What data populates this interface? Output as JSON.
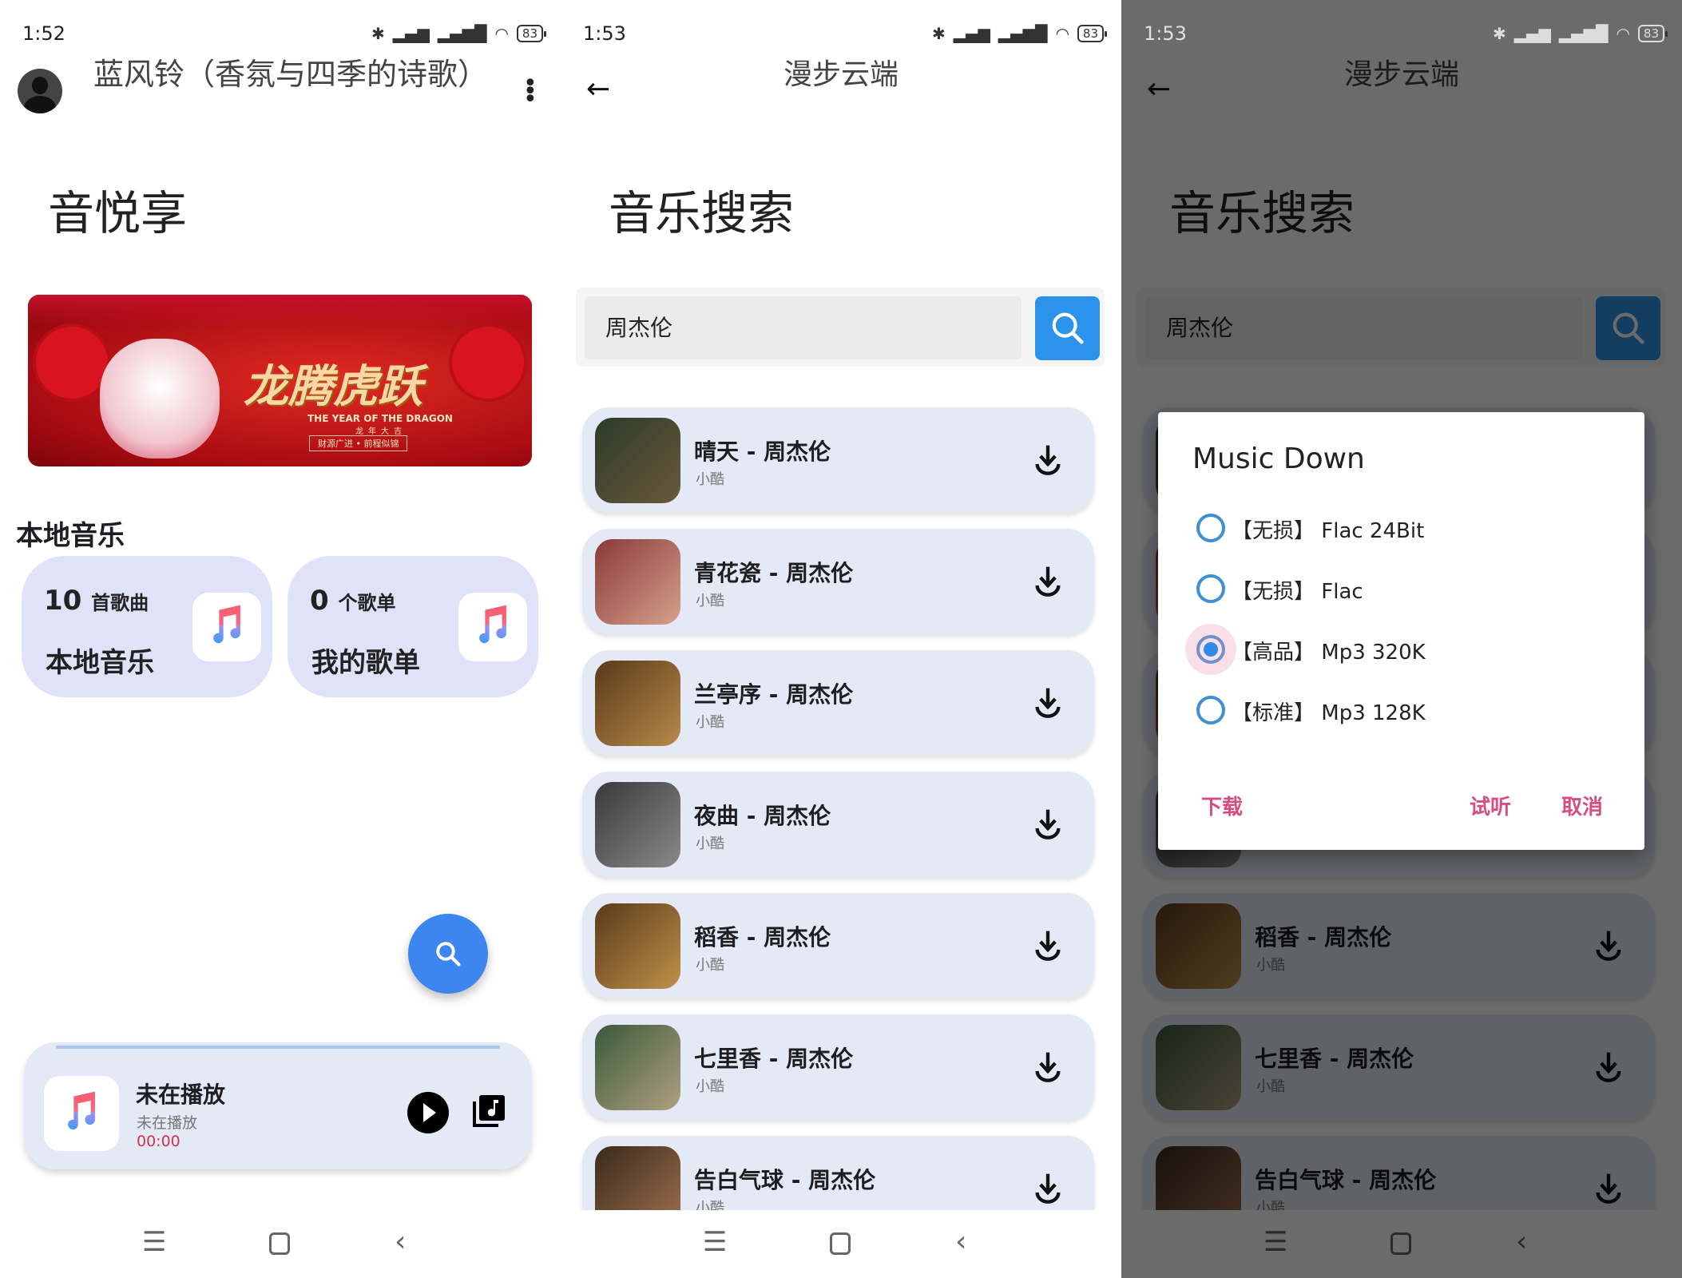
{
  "status": {
    "battery": "83",
    "time1": "1:52",
    "time2": "1:53",
    "time3": "1:53"
  },
  "home": {
    "header_title": "蓝风铃（香氛与四季的诗歌）",
    "app_title": "音悦享",
    "banner": {
      "headline": "龙腾虎跃",
      "sub_en": "THE YEAR OF THE DRAGON",
      "sub_cn": "龙年大吉",
      "motto": "财源广进 • 前程似锦"
    },
    "section_title": "本地音乐",
    "cards": [
      {
        "count": "10",
        "unit": "首歌曲",
        "label": "本地音乐"
      },
      {
        "count": "0",
        "unit": "个歌单",
        "label": "我的歌单"
      }
    ],
    "player": {
      "title": "未在播放",
      "subtitle": "未在播放",
      "time": "00:00"
    }
  },
  "search": {
    "header_title": "漫步云端",
    "page_title": "音乐搜索",
    "query": "周杰伦",
    "results": [
      {
        "title": "晴天 - 周杰伦",
        "source": "小酷"
      },
      {
        "title": "青花瓷 - 周杰伦",
        "source": "小酷"
      },
      {
        "title": "兰亭序 - 周杰伦",
        "source": "小酷"
      },
      {
        "title": "夜曲 - 周杰伦",
        "source": "小酷"
      },
      {
        "title": "稻香 - 周杰伦",
        "source": "小酷"
      },
      {
        "title": "七里香 - 周杰伦",
        "source": "小酷"
      },
      {
        "title": "告白气球 - 周杰伦",
        "source": "小酷"
      }
    ]
  },
  "dialog": {
    "title": "Music Down",
    "options": [
      {
        "label": "【无损】 Flac 24Bit",
        "selected": false
      },
      {
        "label": "【无损】 Flac",
        "selected": false
      },
      {
        "label": "【高品】 Mp3 320K",
        "selected": true
      },
      {
        "label": "【标准】 Mp3 128K",
        "selected": false
      }
    ],
    "download": "下载",
    "preview": "试听",
    "cancel": "取消"
  },
  "colors": {
    "accent": "#2f8ae8",
    "dialog_button": "#d74d82",
    "card": "#e0e2fa",
    "list_item": "#e3e9f5",
    "time_red": "#d0334a"
  }
}
